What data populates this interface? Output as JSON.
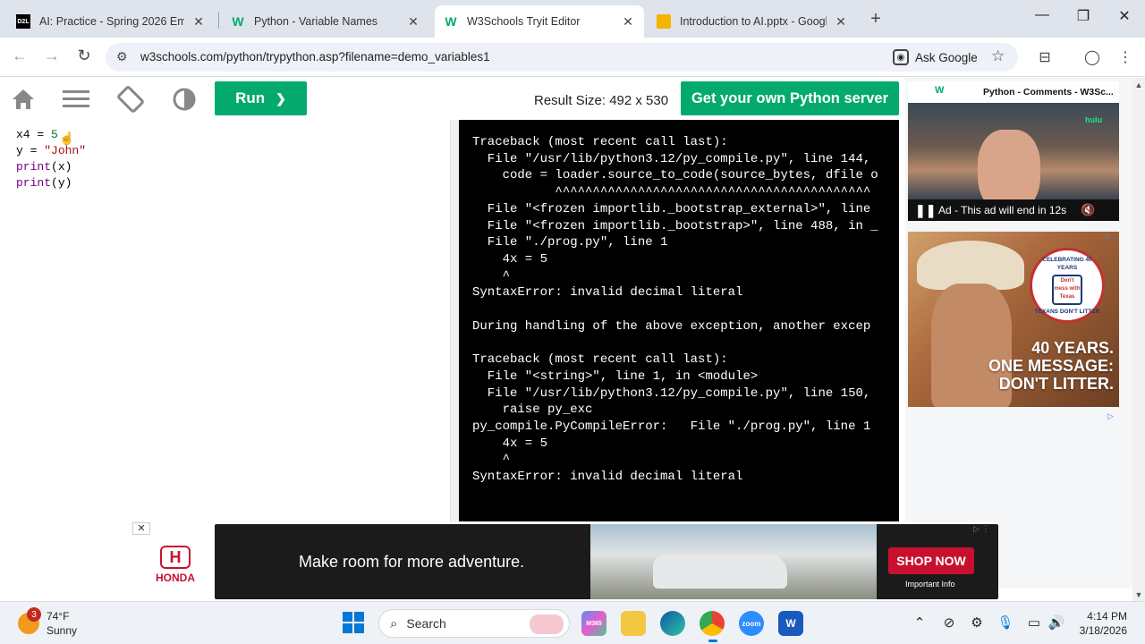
{
  "browser": {
    "tabs": [
      {
        "title": "AI: Practice - Spring 2026 Emer",
        "favicon": "D2L",
        "active": false
      },
      {
        "title": "Python - Variable Names",
        "favicon": "W3",
        "active": false
      },
      {
        "title": "W3Schools Tryit Editor",
        "favicon": "W3",
        "active": true
      },
      {
        "title": "Introduction to AI.pptx - Googl",
        "favicon": "slides",
        "active": false
      }
    ],
    "url": "w3schools.com/python/trypython.asp?filename=demo_variables1",
    "ask_google": "Ask Google"
  },
  "editor": {
    "run_label": "Run",
    "result_size": "Result Size: 492 x 530",
    "get_server": "Get your own Python server",
    "code": {
      "line1_var": "x4",
      "line1_op": " = ",
      "line1_val": "5",
      "line2_var": "y",
      "line2_op": " = ",
      "line2_val": "\"John\"",
      "line3_fn": "print",
      "line3_arg": "(x)",
      "line4_fn": "print",
      "line4_arg": "(y)"
    }
  },
  "output": {
    "lines": [
      "Traceback (most recent call last):",
      "  File \"/usr/lib/python3.12/py_compile.py\", line 144,",
      "    code = loader.source_to_code(source_bytes, dfile o",
      "           ^^^^^^^^^^^^^^^^^^^^^^^^^^^^^^^^^^^^^^^^^^",
      "  File \"<frozen importlib._bootstrap_external>\", line",
      "  File \"<frozen importlib._bootstrap>\", line 488, in _",
      "  File \"./prog.py\", line 1",
      "    4x = 5",
      "    ^",
      "SyntaxError: invalid decimal literal",
      "",
      "During handling of the above exception, another excep",
      "",
      "Traceback (most recent call last):",
      "  File \"<string>\", line 1, in <module>",
      "  File \"/usr/lib/python3.12/py_compile.py\", line 150,",
      "    raise py_exc",
      "py_compile.PyCompileError:   File \"./prog.py\", line 1",
      "    4x = 5",
      "    ^",
      "SyntaxError: invalid decimal literal"
    ]
  },
  "ads": {
    "video_title": "Python - Comments - W3Sc...",
    "video_brand": "hulu",
    "video_status": "Ad - This ad will end in 12s",
    "litter_badge": "CELEBRATING 40 YEARS",
    "litter_badge_inner": "Don't mess with Texas",
    "litter_badge_bottom": "TEXANS DON'T LITTER",
    "litter_line1": "40 YEARS.",
    "litter_line2": "ONE MESSAGE:",
    "litter_line3": "DON'T LITTER.",
    "honda_brand": "HONDA",
    "honda_tagline": "Make room for more adventure.",
    "honda_cta": "SHOP NOW",
    "honda_info": "Important Info"
  },
  "taskbar": {
    "weather_temp": "74°F",
    "weather_cond": "Sunny",
    "weather_badge": "3",
    "search_label": "Search",
    "time": "4:14 PM",
    "date": "3/18/2026"
  }
}
